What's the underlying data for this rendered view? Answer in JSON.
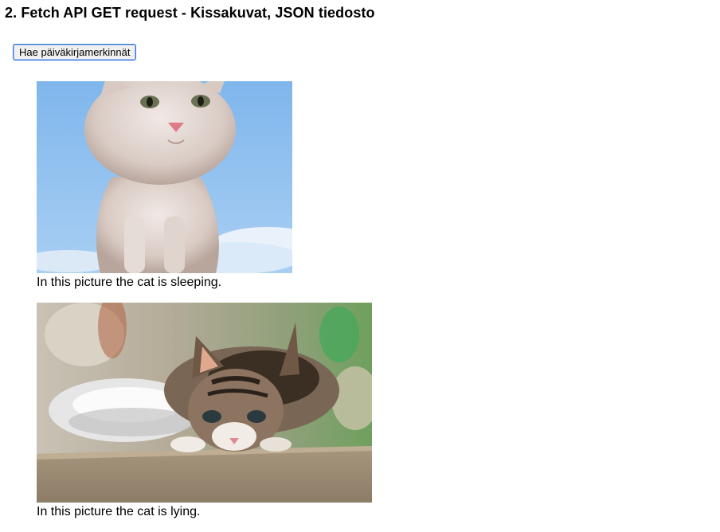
{
  "page": {
    "heading": "2. Fetch API GET request - Kissakuvat, JSON tiedosto",
    "fetch_button_label": "Hae päiväkirjamerkinnät"
  },
  "cats": [
    {
      "caption": "In this picture the cat is sleeping.",
      "image_alt": "white kitten against blue sky",
      "image_icon": "cat-photo-white-kitten"
    },
    {
      "caption": "In this picture the cat is lying.",
      "image_alt": "tabby kitten crouching on a counter",
      "image_icon": "cat-photo-tabby-kitten"
    }
  ],
  "colors": {
    "button_border": "#2f6fd0",
    "sky_blue": "#8dbff0",
    "counter_brown": "#9a8a76"
  }
}
